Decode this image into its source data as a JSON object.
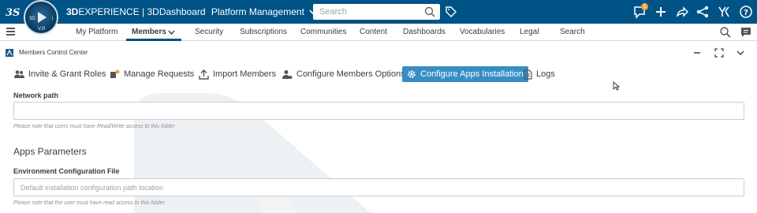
{
  "topbar": {
    "brand_bold": "3D",
    "brand_rest": "EXPERIENCE | 3DDashboard",
    "brand_context": "Platform Management",
    "compass_labels": [
      "3D",
      "V,R",
      "i"
    ],
    "search_placeholder": "Search",
    "notification_count": "1",
    "accent_color": "#005386",
    "icons": [
      "ds-logo-icon",
      "compass-icon",
      "chevron-down-icon",
      "search-icon",
      "tag-icon",
      "notifications-icon",
      "add-icon",
      "share-icon",
      "network-icon",
      "apps-icon",
      "help-icon"
    ]
  },
  "nav": {
    "tabs": [
      {
        "label": "My Platform"
      },
      {
        "label": "Members"
      },
      {
        "label": "Security"
      },
      {
        "label": "Subscriptions"
      },
      {
        "label": "Communities"
      },
      {
        "label": "Content"
      },
      {
        "label": "Dashboards"
      },
      {
        "label": "Vocabularies"
      },
      {
        "label": "Legal"
      },
      {
        "label": "Search"
      }
    ],
    "active_tab": "Members"
  },
  "widget": {
    "title": "Members Control Center"
  },
  "toolbar": {
    "buttons": [
      {
        "label": "Invite & Grant Roles",
        "icon": "users-icon"
      },
      {
        "label": "Manage Requests",
        "icon": "requests-icon"
      },
      {
        "label": "Import Members",
        "icon": "upload-icon"
      },
      {
        "label": "Configure Members Options",
        "icon": "user-settings-icon"
      },
      {
        "label": "Configure Apps Installation",
        "icon": "gear-icon"
      },
      {
        "label": "Logs",
        "icon": "document-icon"
      }
    ],
    "active_button": "Configure Apps Installation",
    "active_color": "#368ec4"
  },
  "form": {
    "network_path": {
      "label": "Network path",
      "value": "",
      "help": "Please note that users must have Read/Write access to this folder"
    },
    "section_title": "Apps Parameters",
    "env_config": {
      "label": "Environment Configuration File",
      "placeholder": "Default installation configuration path location",
      "help": "Please note that the user must have read access to this folder"
    }
  }
}
